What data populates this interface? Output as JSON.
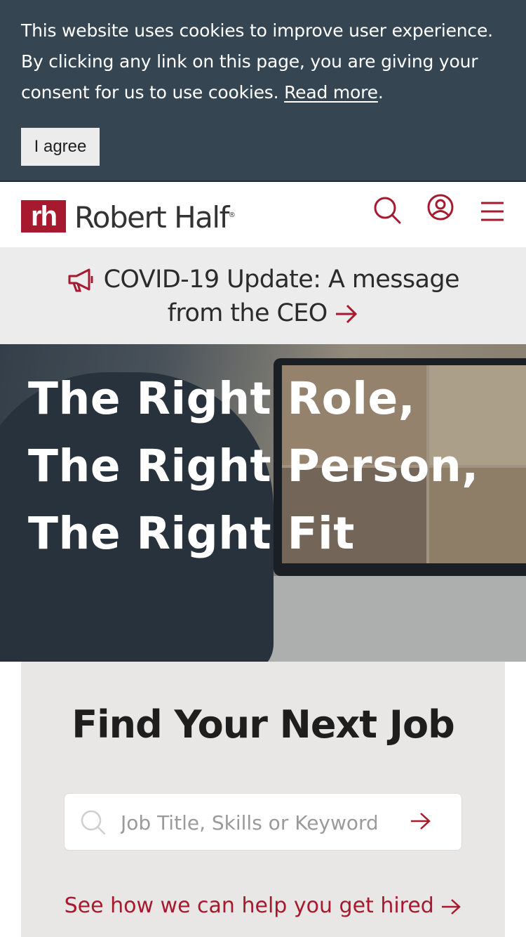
{
  "cookie": {
    "text": "This website uses cookies to improve user experience. By clicking any link on this page, you are giving your consent for us to use cookies. ",
    "link": "Read more",
    "end": ".",
    "agree": "I agree"
  },
  "header": {
    "logo_mark": "rh",
    "logo_text": "Robert Half",
    "logo_reg": "®"
  },
  "covid": {
    "text": "COVID-19 Update: A message from the CEO"
  },
  "hero": {
    "line1": "The Right Role,",
    "line2": "The Right Person,",
    "line3": "The Right Fit"
  },
  "find": {
    "title": "Find Your Next Job",
    "placeholder": "Job Title, Skills or Keywords",
    "help": "See how we can help you get hired"
  },
  "colors": {
    "brand": "#a6192e",
    "banner": "#354552",
    "panel": "#e9e7e5"
  }
}
